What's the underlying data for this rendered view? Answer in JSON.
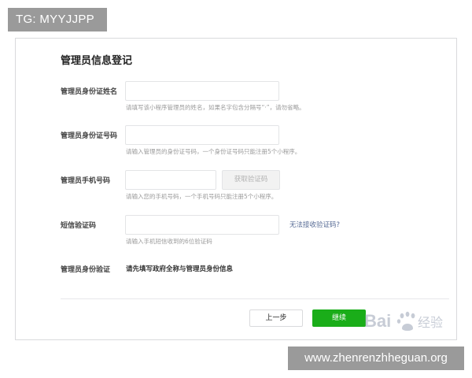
{
  "top_tag": "TG: MYYJJPP",
  "form": {
    "title": "管理员信息登记",
    "name": {
      "label": "管理员身份证姓名",
      "value": "",
      "hint": "请填写该小程序管理员的姓名，如果名字包含分隔号“·”，请勿省略。"
    },
    "id_number": {
      "label": "管理员身份证号码",
      "value": "",
      "hint": "请输入管理员的身份证号码，一个身份证号码只能注册5个小程序。"
    },
    "phone": {
      "label": "管理员手机号码",
      "value": "",
      "get_code_label": "获取验证码",
      "hint": "请输入您的手机号码，一个手机号码只能注册5个小程序。"
    },
    "sms_code": {
      "label": "短信验证码",
      "value": "",
      "help_link": "无法接收验证码?",
      "hint": "请输入手机短信收到的6位验证码"
    },
    "identity_verify": {
      "label": "管理员身份验证",
      "text": "请先填写政府全称与管理员身份信息"
    }
  },
  "buttons": {
    "prev": "上一步",
    "next": "继续"
  },
  "watermark": "Bai 经验",
  "footer_url": "www.zhenrenzhheguan.org",
  "colors": {
    "primary_green": "#1aad19",
    "link_blue": "#576b95",
    "hint_gray": "#9a9a9a",
    "badge_gray": "#9a9a9a"
  }
}
